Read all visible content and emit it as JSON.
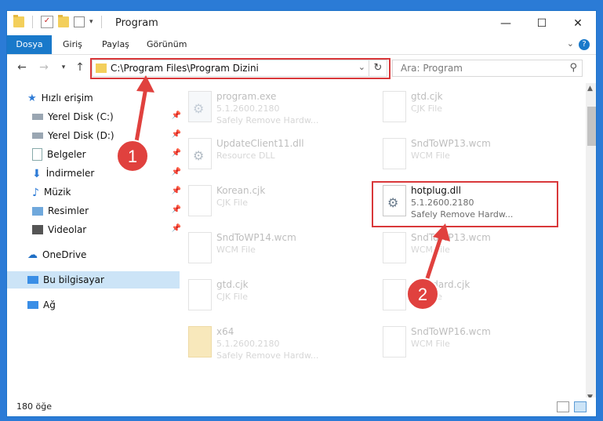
{
  "window": {
    "title": "Program",
    "controls": {
      "minimize": "—",
      "maximize": "☐",
      "close": "✕"
    }
  },
  "ribbon": {
    "tabs": [
      "Dosya",
      "Giriş",
      "Paylaş",
      "Görünüm"
    ],
    "help": "?"
  },
  "navigation": {
    "address": "C:\\Program Files\\Program Dizini",
    "search_placeholder": "Ara: Program"
  },
  "sidebar": {
    "items": [
      {
        "label": "Hızlı erişim",
        "icon": "star-icon"
      },
      {
        "label": "Yerel Disk (C:)",
        "icon": "drive-icon",
        "pinned": true
      },
      {
        "label": "Yerel Disk (D:)",
        "icon": "drive-icon",
        "pinned": true
      },
      {
        "label": "Belgeler",
        "icon": "documents-icon",
        "pinned": true
      },
      {
        "label": "İndirmeler",
        "icon": "download-icon",
        "pinned": true
      },
      {
        "label": "Müzik",
        "icon": "music-icon",
        "pinned": true
      },
      {
        "label": "Resimler",
        "icon": "pictures-icon",
        "pinned": true
      },
      {
        "label": "Videolar",
        "icon": "videos-icon",
        "pinned": true
      },
      {
        "label": "OneDrive",
        "icon": "cloud-icon"
      },
      {
        "label": "Bu bilgisayar",
        "icon": "computer-icon",
        "selected": true
      },
      {
        "label": "Ağ",
        "icon": "network-icon"
      }
    ]
  },
  "files": [
    {
      "name": "program.exe",
      "line2": "5.1.2600.2180",
      "line3": "Safely Remove Hardw...",
      "type": "exe"
    },
    {
      "name": "gtd.cjk",
      "line2": "CJK File",
      "line3": "",
      "type": "doc"
    },
    {
      "name": "UpdateClient11.dll",
      "line2": "Resource DLL",
      "line3": "",
      "type": "gear"
    },
    {
      "name": "SndToWP13.wcm",
      "line2": "WCM File",
      "line3": "",
      "type": "doc"
    },
    {
      "name": "Korean.cjk",
      "line2": "CJK File",
      "line3": "",
      "type": "doc"
    },
    {
      "name": "hotplug.dll",
      "line2": "5.1.2600.2180",
      "line3": "Safely Remove Hardw...",
      "type": "gear",
      "highlighted": true
    },
    {
      "name": "SndToWP14.wcm",
      "line2": "WCM File",
      "line3": "",
      "type": "doc"
    },
    {
      "name": "SndToWP13.wcm",
      "line2": "WCM File",
      "line3": "",
      "type": "doc"
    },
    {
      "name": "gtd.cjk",
      "line2": "CJK File",
      "line3": "",
      "type": "doc"
    },
    {
      "name": "Standard.cjk",
      "line2": "CJK File",
      "line3": "",
      "type": "doc"
    },
    {
      "name": "x64",
      "line2": "5.1.2600.2180",
      "line3": "Safely Remove Hardw...",
      "type": "folder"
    },
    {
      "name": "SndToWP16.wcm",
      "line2": "WCM File",
      "line3": "",
      "type": "doc"
    }
  ],
  "status": {
    "item_count": "180 öğe"
  },
  "annotations": {
    "step1": "1",
    "step2": "2",
    "color": "#d9383a"
  }
}
